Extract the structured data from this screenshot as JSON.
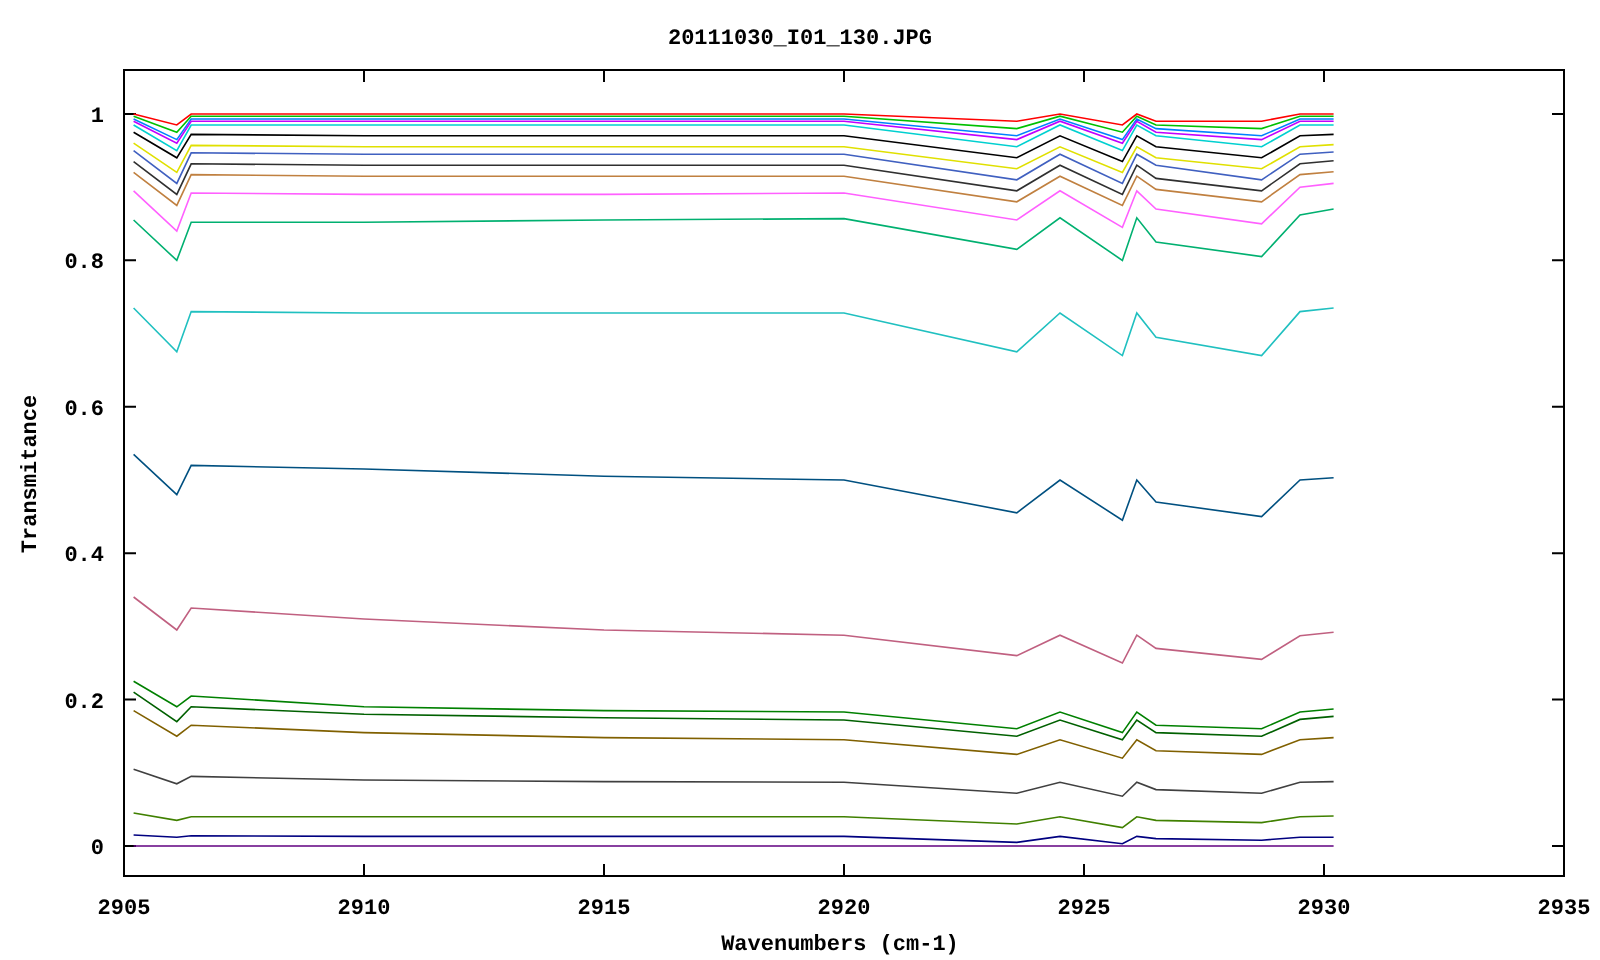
{
  "chart_data": {
    "type": "line",
    "title": "20111030_I01_130.JPG",
    "xlabel": "Wavenumbers (cm-1)",
    "ylabel": "Transmitance",
    "x": [
      2905.2,
      2906.1,
      2906.4,
      2910,
      2915,
      2920,
      2923.6,
      2924.5,
      2925.8,
      2926.1,
      2926.5,
      2928.7,
      2929.5,
      2930.2
    ],
    "xlim": [
      2905,
      2935
    ],
    "ylim": [
      -0.041,
      1.06
    ],
    "xticks": [
      2905,
      2910,
      2915,
      2920,
      2925,
      2930,
      2935
    ],
    "yticks": [
      {
        "value": 0,
        "label": "0"
      },
      {
        "value": 0.2,
        "label": "0.2"
      },
      {
        "value": 0.4,
        "label": "0.4"
      },
      {
        "value": 0.6,
        "label": "0.6"
      },
      {
        "value": 0.8,
        "label": "0.8"
      },
      {
        "value": 1,
        "label": "1"
      }
    ],
    "series": [
      {
        "color": "#ff0000",
        "values": [
          1.0,
          0.985,
          1.0,
          1.0,
          1.0,
          1.0,
          0.99,
          1.0,
          0.985,
          1.0,
          0.99,
          0.99,
          1.0,
          1.0
        ]
      },
      {
        "color": "#00c000",
        "values": [
          0.997,
          0.975,
          0.997,
          0.997,
          0.997,
          0.997,
          0.98,
          0.997,
          0.975,
          0.997,
          0.985,
          0.98,
          0.997,
          0.997
        ]
      },
      {
        "color": "#0080ff",
        "values": [
          0.993,
          0.965,
          0.993,
          0.993,
          0.993,
          0.993,
          0.97,
          0.993,
          0.965,
          0.993,
          0.98,
          0.97,
          0.993,
          0.993
        ]
      },
      {
        "color": "#c000ff",
        "values": [
          0.99,
          0.96,
          0.99,
          0.99,
          0.99,
          0.99,
          0.965,
          0.99,
          0.96,
          0.99,
          0.975,
          0.965,
          0.99,
          0.99
        ]
      },
      {
        "color": "#00d0d0",
        "values": [
          0.985,
          0.95,
          0.985,
          0.985,
          0.985,
          0.985,
          0.955,
          0.985,
          0.95,
          0.985,
          0.97,
          0.955,
          0.985,
          0.985
        ]
      },
      {
        "color": "#000000",
        "values": [
          0.975,
          0.94,
          0.972,
          0.97,
          0.97,
          0.97,
          0.94,
          0.97,
          0.935,
          0.97,
          0.955,
          0.94,
          0.97,
          0.972
        ]
      },
      {
        "color": "#e0e000",
        "values": [
          0.96,
          0.92,
          0.957,
          0.955,
          0.955,
          0.955,
          0.925,
          0.955,
          0.92,
          0.955,
          0.94,
          0.925,
          0.955,
          0.958
        ]
      },
      {
        "color": "#4060c0",
        "values": [
          0.95,
          0.905,
          0.947,
          0.945,
          0.945,
          0.945,
          0.91,
          0.945,
          0.905,
          0.945,
          0.93,
          0.91,
          0.945,
          0.948
        ]
      },
      {
        "color": "#303030",
        "values": [
          0.935,
          0.89,
          0.932,
          0.93,
          0.93,
          0.93,
          0.895,
          0.93,
          0.89,
          0.93,
          0.912,
          0.895,
          0.932,
          0.936
        ]
      },
      {
        "color": "#c08040",
        "values": [
          0.92,
          0.875,
          0.917,
          0.915,
          0.915,
          0.915,
          0.88,
          0.915,
          0.875,
          0.915,
          0.897,
          0.88,
          0.917,
          0.921
        ]
      },
      {
        "color": "#ff60ff",
        "values": [
          0.895,
          0.84,
          0.892,
          0.89,
          0.89,
          0.892,
          0.855,
          0.895,
          0.845,
          0.895,
          0.87,
          0.85,
          0.9,
          0.905
        ]
      },
      {
        "color": "#00b070",
        "values": [
          0.855,
          0.8,
          0.852,
          0.852,
          0.855,
          0.857,
          0.815,
          0.858,
          0.8,
          0.858,
          0.825,
          0.805,
          0.862,
          0.87
        ]
      },
      {
        "color": "#20c0c0",
        "values": [
          0.735,
          0.675,
          0.73,
          0.728,
          0.728,
          0.728,
          0.675,
          0.728,
          0.67,
          0.728,
          0.695,
          0.67,
          0.73,
          0.735
        ]
      },
      {
        "color": "#005080",
        "values": [
          0.535,
          0.48,
          0.52,
          0.515,
          0.505,
          0.5,
          0.455,
          0.5,
          0.445,
          0.5,
          0.47,
          0.45,
          0.5,
          0.503
        ]
      },
      {
        "color": "#c06080",
        "values": [
          0.34,
          0.295,
          0.325,
          0.31,
          0.295,
          0.288,
          0.26,
          0.288,
          0.25,
          0.288,
          0.27,
          0.255,
          0.287,
          0.292
        ]
      },
      {
        "color": "#008000",
        "values": [
          0.225,
          0.19,
          0.205,
          0.19,
          0.185,
          0.183,
          0.16,
          0.183,
          0.155,
          0.183,
          0.165,
          0.16,
          0.183,
          0.187
        ]
      },
      {
        "color": "#006000",
        "values": [
          0.21,
          0.17,
          0.19,
          0.18,
          0.175,
          0.172,
          0.15,
          0.172,
          0.145,
          0.172,
          0.155,
          0.15,
          0.173,
          0.177
        ]
      },
      {
        "color": "#806000",
        "values": [
          0.185,
          0.15,
          0.165,
          0.155,
          0.148,
          0.145,
          0.125,
          0.145,
          0.12,
          0.145,
          0.13,
          0.125,
          0.145,
          0.148
        ]
      },
      {
        "color": "#404040",
        "values": [
          0.105,
          0.085,
          0.095,
          0.09,
          0.088,
          0.087,
          0.072,
          0.087,
          0.068,
          0.087,
          0.077,
          0.072,
          0.087,
          0.088
        ]
      },
      {
        "color": "#408000",
        "values": [
          0.045,
          0.035,
          0.04,
          0.04,
          0.04,
          0.04,
          0.03,
          0.04,
          0.025,
          0.04,
          0.035,
          0.032,
          0.04,
          0.041
        ]
      },
      {
        "color": "#000080",
        "values": [
          0.015,
          0.012,
          0.014,
          0.013,
          0.013,
          0.013,
          0.005,
          0.013,
          0.003,
          0.013,
          0.01,
          0.008,
          0.012,
          0.012
        ]
      },
      {
        "color": "#600080",
        "values": [
          0.0,
          0.0,
          0.0,
          0.0,
          0.0,
          0.0,
          0.0,
          0.0,
          0.0,
          0.0,
          0.0,
          0.0,
          0.0,
          0.0
        ]
      }
    ]
  }
}
